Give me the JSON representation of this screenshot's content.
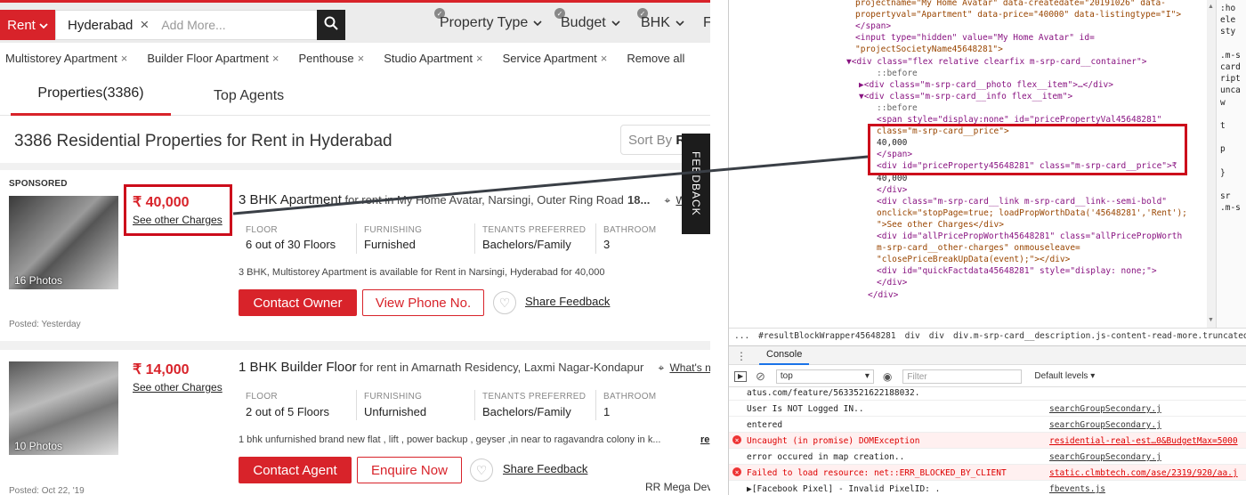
{
  "header": {
    "rent_label": "Rent",
    "city": "Hyderabad",
    "add_more_placeholder": "Add More...",
    "filters": [
      "Property Type",
      "Budget",
      "BHK",
      "F"
    ]
  },
  "chips": [
    "Multistorey Apartment",
    "Builder Floor Apartment",
    "Penthouse",
    "Studio Apartment",
    "Service Apartment"
  ],
  "remove_all": "Remove all",
  "tabs": {
    "properties": "Properties(3386)",
    "agents": "Top Agents"
  },
  "results_title": "3386 Residential Properties for Rent in Hyderabad",
  "sort": {
    "label": "Sort By",
    "value": "R"
  },
  "feedback_tab": "FEEDBACK",
  "cards": [
    {
      "sponsored": "SPONSORED",
      "photos": "16 Photos",
      "price": "₹ 40,000",
      "other_charges": "See other Charges",
      "title": "3 BHK Apartment",
      "subtitle": " for rent in My Home Avatar, Narsingi, Outer Ring Road",
      "sub_extra": "18...",
      "loc_link": "W",
      "facts": [
        {
          "label": "FLOOR",
          "value": "6 out of 30 Floors"
        },
        {
          "label": "FURNISHING",
          "value": "Furnished"
        },
        {
          "label": "TENANTS PREFERRED",
          "value": "Bachelors/Family"
        },
        {
          "label": "BATHROOM",
          "value": "3"
        }
      ],
      "desc": "3 BHK, Multistorey Apartment is available for Rent in Narsingi, Hyderabad for 40,000",
      "primary_btn": "Contact Owner",
      "secondary_btn": "View Phone No.",
      "share": "Share Feedback",
      "posted": "Posted: Yesterday"
    },
    {
      "photos": "10 Photos",
      "price": "₹ 14,000",
      "other_charges": "See other Charges",
      "title": "1 BHK Builder Floor",
      "subtitle": " for rent in Amarnath Residency, Laxmi Nagar-Kondapur",
      "loc_link": "What's n",
      "facts": [
        {
          "label": "FLOOR",
          "value": "2 out of 5 Floors"
        },
        {
          "label": "FURNISHING",
          "value": "Unfurnished"
        },
        {
          "label": "TENANTS PREFERRED",
          "value": "Bachelors/Family"
        },
        {
          "label": "BATHROOM",
          "value": "1"
        }
      ],
      "desc": "1 bhk unfurnished brand new flat , lift , power backup , geyser ,in near to ragavandra colony in k...",
      "read_more": "re",
      "primary_btn": "Contact Agent",
      "secondary_btn": "Enquire Now",
      "share": "Share Feedback",
      "posted": "Posted: Oct 22, '19",
      "dealer": "RR Mega Dev"
    }
  ],
  "devtools": {
    "elements_lines": [
      "projectname=\"My Home Avatar\" data-createdate=\"20191026\" data-",
      "propertyval=\"Apartment\" data-price=\"40000\" data-listingtype=\"I\">",
      "</span>",
      "<input type=\"hidden\" value=\"My Home Avatar\" id=",
      "\"projectSocietyName45648281\">",
      "▼<div class=\"flex relative clearfix m-srp-card__container\">",
      "::before",
      "▶<div class=\"m-srp-card__photo flex__item\">…</div>",
      "▼<div class=\"m-srp-card__info flex__item\">",
      "::before",
      "<span style=\"display:none\" id=\"pricePropertyVal45648281\"",
      "class=\"m-srp-card__price\">",
      "40,000",
      "</span>",
      "<div id=\"priceProperty45648281\" class=\"m-srp-card__price\">₹",
      "40,000",
      "</div>",
      "<div class=\"m-srp-card__link m-srp-card__link--semi-bold\"",
      "onclick=\"stopPage=true; loadPropWorthData('45648281','Rent');",
      "\">See other Charges</div>",
      "<div id=\"allPricePropWorth45648281\" class=\"allPricePropWorth",
      "m-srp-card__other-charges\" onmouseleave=",
      "\"closePriceBreakUpData(event);\"></div>",
      "<div id=\"quickFactdata45648281\" style=\"display: none;\">",
      "</div>",
      "</div>"
    ],
    "styles_lines": [
      ":ho",
      "ele",
      "sty",
      "",
      ".m-s",
      "card",
      "ript",
      "unca",
      "w",
      "",
      "t",
      "",
      "p",
      "",
      "}",
      "",
      "sr",
      ".m-s"
    ],
    "breadcrumb": [
      "...",
      "#resultBlockWrapper45648281",
      "div",
      "div",
      "div.m-srp-card__description.js-content-read-more.truncated"
    ],
    "console_tab": "Console",
    "context": "top",
    "filter_placeholder": "Filter",
    "levels": "Default levels ▾",
    "console_lines": [
      {
        "msg": "atus.com/feature/5633521622188032.",
        "src": "",
        "error": false
      },
      {
        "msg": "User Is NOT Logged IN..",
        "src": "searchGroupSecondary.j",
        "error": false
      },
      {
        "msg": "entered",
        "src": "searchGroupSecondary.j",
        "error": false
      },
      {
        "msg": "Uncaught (in promise) DOMException",
        "src": "residential-real-est…0&BudgetMax=5000",
        "error": true
      },
      {
        "msg": "error occured in map creation..",
        "src": "searchGroupSecondary.j",
        "error": false
      },
      {
        "msg": "Failed to load resource: net::ERR_BLOCKED_BY_CLIENT",
        "src": "static.clmbtech.com/ase/2319/920/aa.j",
        "error": true
      },
      {
        "msg": "▶[Facebook Pixel] - Invalid PixelID: .",
        "src": "fbevents.js",
        "error": false
      }
    ]
  },
  "colors": {
    "brand": "#d8232a",
    "highlight": "#cc0c1b"
  }
}
